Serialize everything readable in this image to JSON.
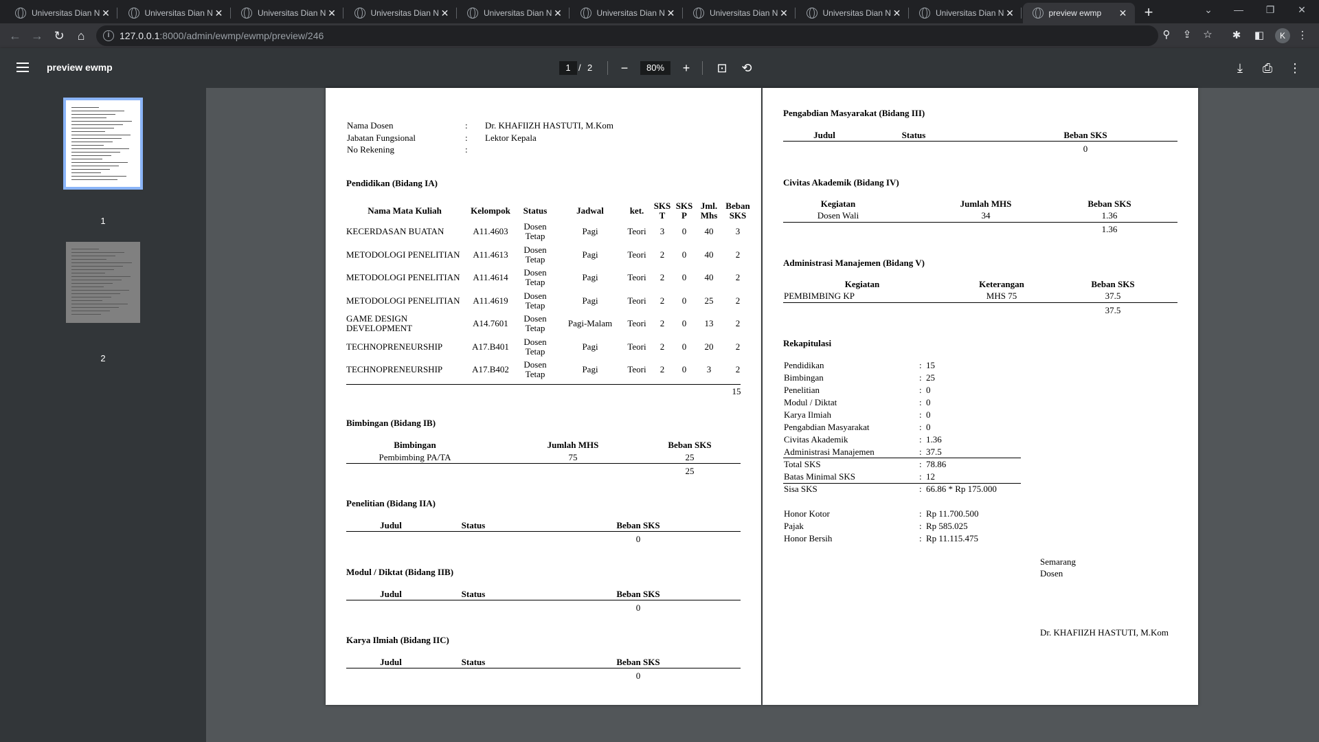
{
  "browser": {
    "tabs": [
      {
        "title": "Universitas Dian Nuswantoro"
      },
      {
        "title": "Universitas Dian Nuswantoro"
      },
      {
        "title": "Universitas Dian Nuswantoro"
      },
      {
        "title": "Universitas Dian Nuswantoro"
      },
      {
        "title": "Universitas Dian Nuswantoro"
      },
      {
        "title": "Universitas Dian Nuswantoro"
      },
      {
        "title": "Universitas Dian Nuswantoro"
      },
      {
        "title": "Universitas Dian Nuswantoro"
      },
      {
        "title": "Universitas Dian Nuswantoro"
      },
      {
        "title": "preview ewmp"
      }
    ],
    "url_host": "127.0.0.1",
    "url_rest": ":8000/admin/ewmp/ewmp/preview/246",
    "profile_initial": "K"
  },
  "pdf": {
    "title": "preview ewmp",
    "current_page": "1",
    "page_sep": "/",
    "total_pages": "2",
    "zoom": "80%",
    "thumb_labels": [
      "1",
      "2"
    ]
  },
  "doc": {
    "header": {
      "nama_label": "Nama Dosen",
      "nama_value": "Dr. KHAFIIZH HASTUTI, M.Kom",
      "jabatan_label": "Jabatan Fungsional",
      "jabatan_value": "Lektor Kepala",
      "rekening_label": "No Rekening",
      "colon": ":"
    },
    "pendidikan": {
      "title": "Pendidikan (Bidang IA)",
      "headers": [
        "Nama Mata Kuliah",
        "Kelompok",
        "Status",
        "Jadwal",
        "ket.",
        "SKS T",
        "SKS P",
        "Jml. Mhs",
        "Beban SKS"
      ],
      "rows": [
        [
          "KECERDASAN BUATAN",
          "A11.4603",
          "Dosen Tetap",
          "Pagi",
          "Teori",
          "3",
          "0",
          "40",
          "3"
        ],
        [
          "METODOLOGI PENELITIAN",
          "A11.4613",
          "Dosen Tetap",
          "Pagi",
          "Teori",
          "2",
          "0",
          "40",
          "2"
        ],
        [
          "METODOLOGI PENELITIAN",
          "A11.4614",
          "Dosen Tetap",
          "Pagi",
          "Teori",
          "2",
          "0",
          "40",
          "2"
        ],
        [
          "METODOLOGI PENELITIAN",
          "A11.4619",
          "Dosen Tetap",
          "Pagi",
          "Teori",
          "2",
          "0",
          "25",
          "2"
        ],
        [
          "GAME DESIGN DEVELOPMENT",
          "A14.7601",
          "Dosen Tetap",
          "Pagi-Malam",
          "Teori",
          "2",
          "0",
          "13",
          "2"
        ],
        [
          "TECHNOPRENEURSHIP",
          "A17.B401",
          "Dosen Tetap",
          "Pagi",
          "Teori",
          "2",
          "0",
          "20",
          "2"
        ],
        [
          "TECHNOPRENEURSHIP",
          "A17.B402",
          "Dosen Tetap",
          "Pagi",
          "Teori",
          "2",
          "0",
          "3",
          "2"
        ]
      ],
      "total": "15"
    },
    "bimbingan": {
      "title": "Bimbingan (Bidang IB)",
      "headers": [
        "Bimbingan",
        "Jumlah MHS",
        "Beban SKS"
      ],
      "row": [
        "Pembimbing PA/TA",
        "75",
        "25"
      ],
      "total": "25"
    },
    "penelitian": {
      "title": "Penelitian (Bidang IIA)",
      "headers": [
        "Judul",
        "Status",
        "Beban SKS"
      ],
      "total": "0"
    },
    "modul": {
      "title": "Modul / Diktat (Bidang IIB)",
      "headers": [
        "Judul",
        "Status",
        "Beban SKS"
      ],
      "total": "0"
    },
    "karya": {
      "title": "Karya Ilmiah (Bidang IIC)",
      "headers": [
        "Judul",
        "Status",
        "Beban SKS"
      ],
      "total": "0"
    },
    "pengabdian": {
      "title": "Pengabdian Masyarakat (Bidang III)",
      "headers": [
        "Judul",
        "Status",
        "Beban SKS"
      ],
      "total": "0"
    },
    "civitas": {
      "title": "Civitas Akademik (Bidang IV)",
      "headers": [
        "Kegiatan",
        "Jumlah MHS",
        "Beban SKS"
      ],
      "row": [
        "Dosen Wali",
        "34",
        "1.36"
      ],
      "total": "1.36"
    },
    "administrasi": {
      "title": "Administrasi Manajemen (Bidang V)",
      "headers": [
        "Kegiatan",
        "Keterangan",
        "Beban SKS"
      ],
      "row": [
        "PEMBIMBING KP",
        "MHS 75",
        "37.5"
      ],
      "total": "37.5"
    },
    "rekap": {
      "title": "Rekapitulasi",
      "rows": [
        [
          "Pendidikan",
          "15"
        ],
        [
          "Bimbingan",
          "25"
        ],
        [
          "Penelitian",
          "0"
        ],
        [
          "Modul / Diktat",
          "0"
        ],
        [
          "Karya Ilmiah",
          "0"
        ],
        [
          "Pengabdian Masyarakat",
          "0"
        ],
        [
          "Civitas Akademik",
          "1.36"
        ],
        [
          "Administrasi Manajemen",
          "37.5"
        ],
        [
          "Total SKS",
          "78.86"
        ],
        [
          "Batas Minimal SKS",
          "12"
        ],
        [
          "Sisa SKS",
          "66.86 * Rp 175.000"
        ],
        [
          "Honor Kotor",
          "Rp 11.700.500"
        ],
        [
          "Pajak",
          "Rp 585.025"
        ],
        [
          "Honor Bersih",
          "Rp 11.115.475"
        ]
      ]
    },
    "signature": {
      "city": "Semarang",
      "role": "Dosen",
      "name": "Dr. KHAFIIZH HASTUTI, M.Kom"
    }
  }
}
